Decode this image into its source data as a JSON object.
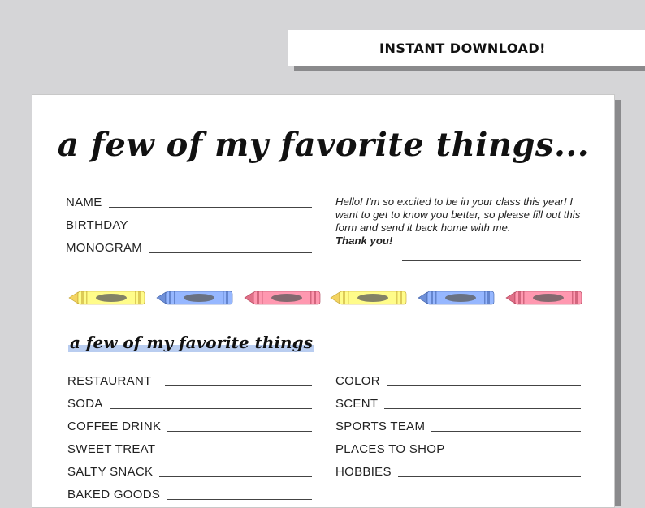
{
  "banner": {
    "text": "INSTANT DOWNLOAD!"
  },
  "sheet": {
    "title": "a few of my favorite things...",
    "personal_fields": [
      {
        "label": "NAME"
      },
      {
        "label": "BIRTHDAY"
      },
      {
        "label": "MONOGRAM"
      }
    ],
    "note": {
      "body": "Hello! I'm so excited to be in your class this year! I want to get to know you better, so please fill out this form and send it back home with me.",
      "thanks": "Thank you!"
    },
    "crayon_colors": [
      "#f3d462",
      "#6e8fd8",
      "#e07088",
      "#f3d462",
      "#6e8fd8",
      "#e07088"
    ],
    "subtitle": "a few of my favorite things",
    "subtitle_highlight": "#b9cdf0",
    "favorites_left": [
      {
        "label": "RESTAURANT"
      },
      {
        "label": "SODA"
      },
      {
        "label": "COFFEE DRINK"
      },
      {
        "label": "SWEET TREAT"
      },
      {
        "label": "SALTY SNACK"
      },
      {
        "label": "BAKED GOODS"
      }
    ],
    "favorites_right": [
      {
        "label": "COLOR"
      },
      {
        "label": "SCENT"
      },
      {
        "label": "SPORTS TEAM"
      },
      {
        "label": "PLACES TO SHOP"
      },
      {
        "label": "HOBBIES"
      }
    ]
  }
}
